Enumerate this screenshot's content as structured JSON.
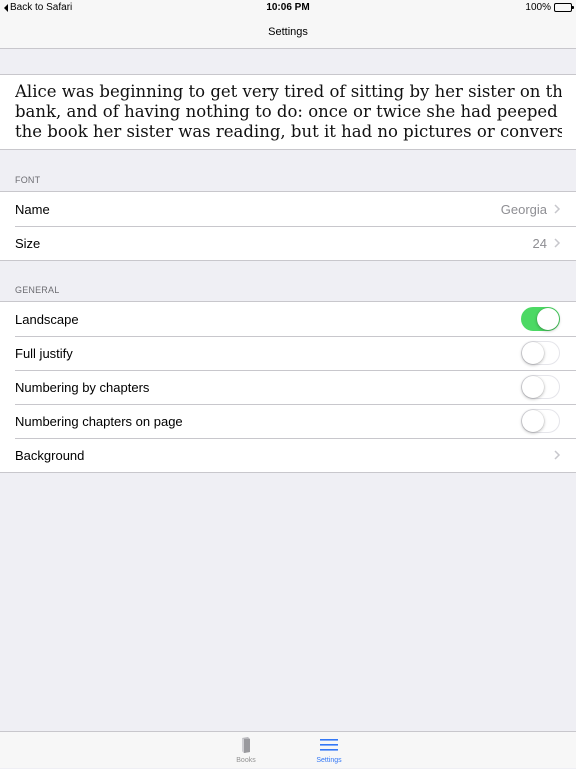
{
  "status_bar": {
    "back_label": "Back to Safari",
    "time": "10:06 PM",
    "battery": "100%"
  },
  "nav": {
    "title": "Settings"
  },
  "preview": {
    "lines": [
      "Alice was beginning to get very tired of sitting by her sister on the",
      "bank, and of having nothing to do: once or twice she had peeped into",
      "the book her sister was reading, but it had no pictures or conversat..."
    ]
  },
  "font_section": {
    "header": "FONT",
    "name_label": "Name",
    "name_value": "Georgia",
    "size_label": "Size",
    "size_value": "24"
  },
  "general_section": {
    "header": "GENERAL",
    "landscape_label": "Landscape",
    "landscape_on": true,
    "full_justify_label": "Full justify",
    "full_justify_on": false,
    "numbering_by_chapters_label": "Numbering by chapters",
    "numbering_by_chapters_on": false,
    "numbering_on_page_label": "Numbering chapters on page",
    "numbering_on_page_on": false,
    "background_label": "Background"
  },
  "tab_bar": {
    "books_label": "Books",
    "settings_label": "Settings",
    "active_tab": "Settings",
    "icons": {
      "books": "book-icon",
      "settings": "list-icon"
    }
  },
  "colors": {
    "accent": "#3478f6",
    "toggle_on": "#4cd964",
    "background": "#efeff4"
  }
}
